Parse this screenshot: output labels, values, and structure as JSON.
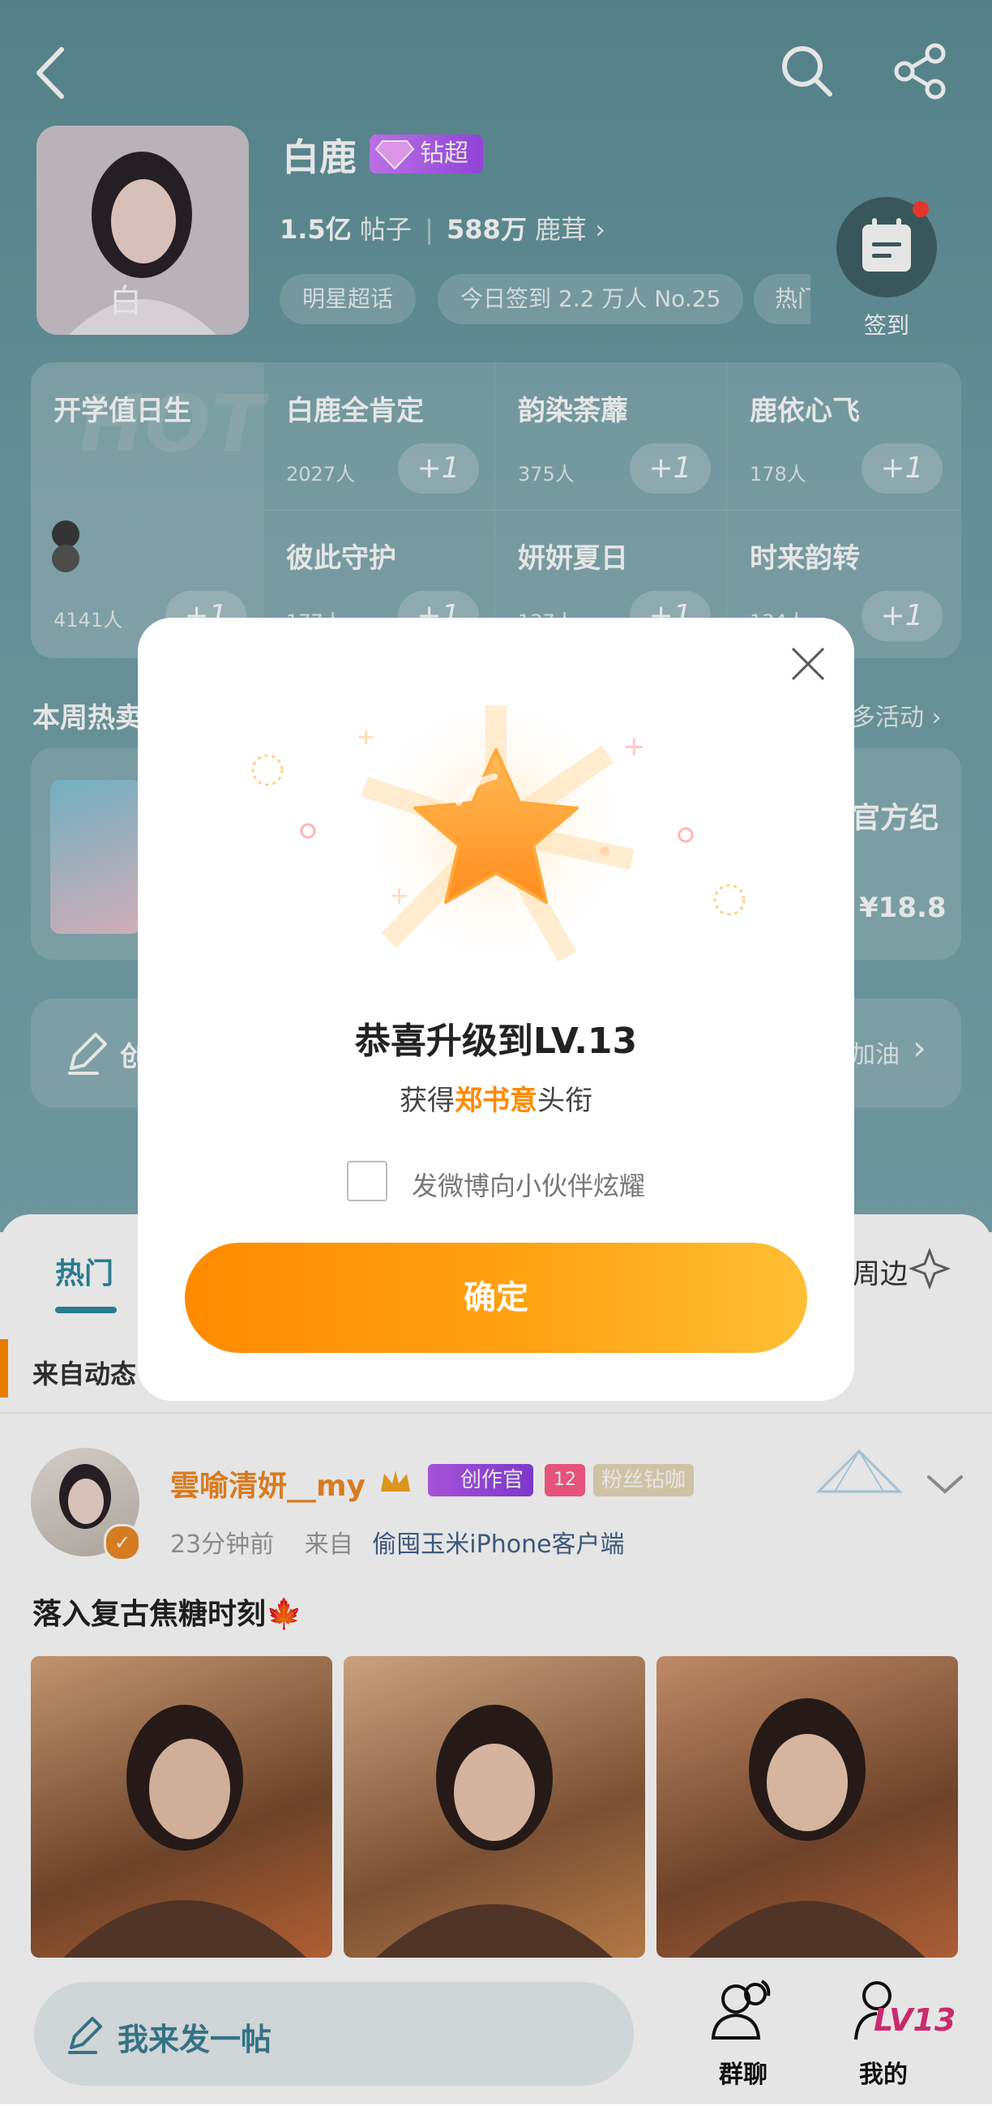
{
  "header": {
    "star_name": "白鹿",
    "badge_label": "钻超",
    "posts_value": "1.5亿",
    "posts_label": "帖子",
    "fans_value": "588万",
    "fans_label": "鹿茸",
    "chips": [
      "明星超话",
      "今日签到 2.2 万人  No.25",
      "热门"
    ],
    "signin_label": "签到"
  },
  "groups": {
    "hot_title": "开学值日生",
    "hot_count": "4141人",
    "items": [
      {
        "name": "白鹿全肯定",
        "count": "2027人"
      },
      {
        "name": "韵染荼蘼",
        "count": "375人"
      },
      {
        "name": "鹿依心飞",
        "count": "178人"
      },
      {
        "name": "彼此守护",
        "count": "177人"
      },
      {
        "name": "妍妍夏日",
        "count": "137人"
      },
      {
        "name": "时来韵转",
        "count": "134人"
      }
    ],
    "plus_label": "+1"
  },
  "weekly": {
    "title": "本周热卖",
    "more": "多活动",
    "product_title": "官方纪",
    "price": "¥18.8",
    "create_label": "创",
    "cheer_label": "加油"
  },
  "feed": {
    "tab_hot": "热门",
    "tab_nearby": "周边",
    "auto_label": "来自动态",
    "post": {
      "username": "雲喻清妍__my",
      "badge_creator": "创作官",
      "badge_level": "12",
      "badge_fan": "粉丝钻咖",
      "time": "23分钟前",
      "from_label": "来自",
      "source": "偷囤玉米iPhone客户端",
      "text": "落入复古焦糖时刻🍁"
    }
  },
  "bottom_bar": {
    "write_label": "我来发一帖",
    "group_chat_label": "群聊",
    "mine_label": "我的",
    "mine_level": "LV13"
  },
  "modal": {
    "title": "恭喜升级到LV.13",
    "sub_prefix": "获得",
    "sub_highlight": "郑书意",
    "sub_suffix": "头衔",
    "checkbox_label": "发微博向小伙伴炫耀",
    "confirm_label": "确定"
  },
  "colors": {
    "accent_orange": "#ff8a00",
    "teal": "#2e8aa0",
    "header_bg": "#6f9ea6"
  }
}
